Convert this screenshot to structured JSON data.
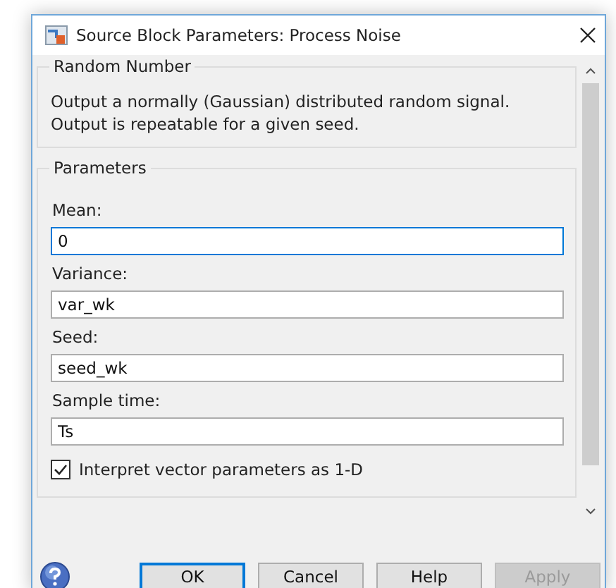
{
  "window": {
    "title": "Source Block Parameters: Process Noise"
  },
  "description_group": {
    "title": "Random Number",
    "text": "Output a normally (Gaussian) distributed random signal.\nOutput is repeatable for a given seed."
  },
  "parameters_group": {
    "title": "Parameters",
    "fields": [
      {
        "label": "Mean:",
        "value": "0",
        "focused": true
      },
      {
        "label": "Variance:",
        "value": "var_wk",
        "focused": false
      },
      {
        "label": "Seed:",
        "value": "seed_wk",
        "focused": false
      },
      {
        "label": "Sample time:",
        "value": "Ts",
        "focused": false
      }
    ],
    "checkbox": {
      "label": "Interpret vector parameters as 1-D",
      "checked": true
    }
  },
  "buttons": [
    {
      "label": "OK",
      "default": true,
      "disabled": false
    },
    {
      "label": "Cancel",
      "default": false,
      "disabled": false
    },
    {
      "label": "Help",
      "default": false,
      "disabled": false
    },
    {
      "label": "Apply",
      "default": false,
      "disabled": true
    }
  ]
}
